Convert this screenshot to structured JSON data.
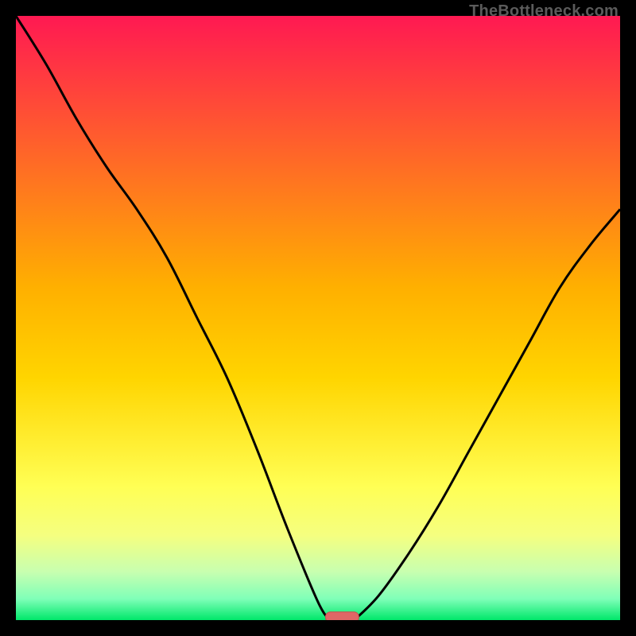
{
  "watermark": "TheBottleneck.com",
  "colors": {
    "bg": "#000000",
    "grad_top": "#ff1952",
    "grad_mid": "#ffd100",
    "grad_low": "#ffff66",
    "grad_lower": "#dcff8a",
    "grad_bottom": "#00e76a",
    "curve": "#000000",
    "marker_fill": "#e06666",
    "marker_stroke": "#c84f4f"
  },
  "chart_data": {
    "type": "line",
    "title": "",
    "subtitle": "",
    "xlabel": "",
    "ylabel": "",
    "xlim": [
      0,
      100
    ],
    "ylim": [
      0,
      100
    ],
    "legend_position": "none",
    "series": [
      {
        "name": "bottleneck-curve-left",
        "x": [
          0,
          5,
          10,
          15,
          20,
          25,
          30,
          35,
          40,
          45,
          50,
          52
        ],
        "y": [
          100,
          92,
          83,
          75,
          68,
          60,
          50,
          40,
          28,
          15,
          3,
          0
        ]
      },
      {
        "name": "bottleneck-curve-right",
        "x": [
          56,
          60,
          65,
          70,
          75,
          80,
          85,
          90,
          95,
          100
        ],
        "y": [
          0,
          4,
          11,
          19,
          28,
          37,
          46,
          55,
          62,
          68
        ]
      }
    ],
    "marker": {
      "name": "optimal-marker",
      "x_center": 54,
      "width": 5.5,
      "y": 0.5
    },
    "gradient_stops": [
      {
        "offset": 0.0,
        "color": "#ff1952"
      },
      {
        "offset": 0.45,
        "color": "#ffb000"
      },
      {
        "offset": 0.6,
        "color": "#ffd500"
      },
      {
        "offset": 0.78,
        "color": "#ffff55"
      },
      {
        "offset": 0.86,
        "color": "#f5ff80"
      },
      {
        "offset": 0.92,
        "color": "#c8ffb0"
      },
      {
        "offset": 0.965,
        "color": "#7fffb8"
      },
      {
        "offset": 1.0,
        "color": "#00e76a"
      }
    ]
  }
}
